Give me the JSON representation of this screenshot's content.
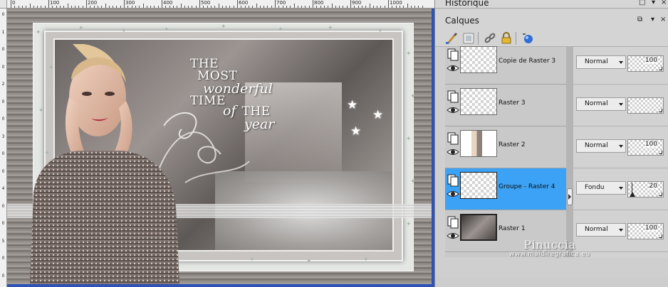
{
  "ruler": {
    "top_labels": [
      "0",
      "100",
      "200",
      "300",
      "400",
      "500",
      "600",
      "700",
      "800",
      "900",
      "1000"
    ],
    "left_labels": [
      "0",
      "1",
      "0",
      "0",
      "2",
      "0",
      "0",
      "3",
      "0",
      "0",
      "4",
      "0",
      "0",
      "5",
      "0",
      "0"
    ]
  },
  "artwork": {
    "title_line1": "THE",
    "title_line2": "MOST",
    "title_line3": "wonderful",
    "title_line4": "TIME",
    "title_line5": "of",
    "title_line6": "THE",
    "title_line7": "year"
  },
  "panels": {
    "historique": "Historique",
    "calques": "Calques"
  },
  "toolbar": {
    "icons": [
      "brush-icon",
      "mask-icon",
      "link-icon",
      "lock-icon",
      "pin-icon"
    ]
  },
  "layers": [
    {
      "name": "Copie de Raster 3",
      "blend": "Normal",
      "opacity": "100",
      "selected": false
    },
    {
      "name": "Raster 3",
      "blend": "Normal",
      "opacity": "",
      "selected": false
    },
    {
      "name": "Raster 2",
      "blend": "Normal",
      "opacity": "100",
      "selected": false
    },
    {
      "name": "Groupe - Raster 4",
      "blend": "Fondu",
      "opacity": "20",
      "selected": true
    },
    {
      "name": "Raster 1",
      "blend": "Normal",
      "opacity": "100",
      "selected": false
    }
  ],
  "watermark": {
    "name": "Pinuccia",
    "url": "www.maidiregrafica.eu"
  },
  "colors": {
    "selected_row": "#3ba2f5",
    "canvas_border": "#2d52b8"
  }
}
